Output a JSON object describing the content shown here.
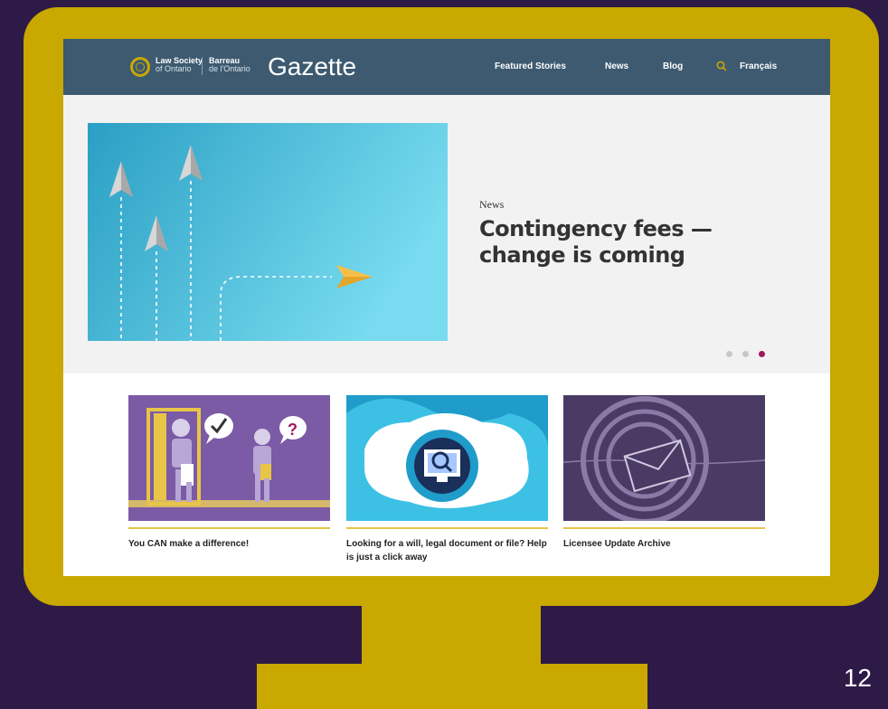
{
  "header": {
    "logo_en_line1": "Law Society",
    "logo_en_line2": "of Ontario",
    "logo_fr_line1": "Barreau",
    "logo_fr_line2": "de l'Ontario",
    "site_title": "Gazette",
    "nav": [
      "Featured Stories",
      "News",
      "Blog"
    ],
    "language_link": "Français",
    "search_icon": "search-icon"
  },
  "hero": {
    "kicker": "News",
    "title": "Contingency fees — change is coming",
    "carousel_dot_count": 3,
    "carousel_active_index": 2
  },
  "cards": [
    {
      "title": "You CAN make a difference!"
    },
    {
      "title": "Looking for a will, legal document or file? Help is just a click away"
    },
    {
      "title": "Licensee Update Archive"
    }
  ],
  "colors": {
    "background": "#2e1a47",
    "monitor": "#c9a800",
    "header": "#3d5a70",
    "accent": "#a3185e",
    "card_rule": "#e8c547"
  },
  "slide_number": "12"
}
